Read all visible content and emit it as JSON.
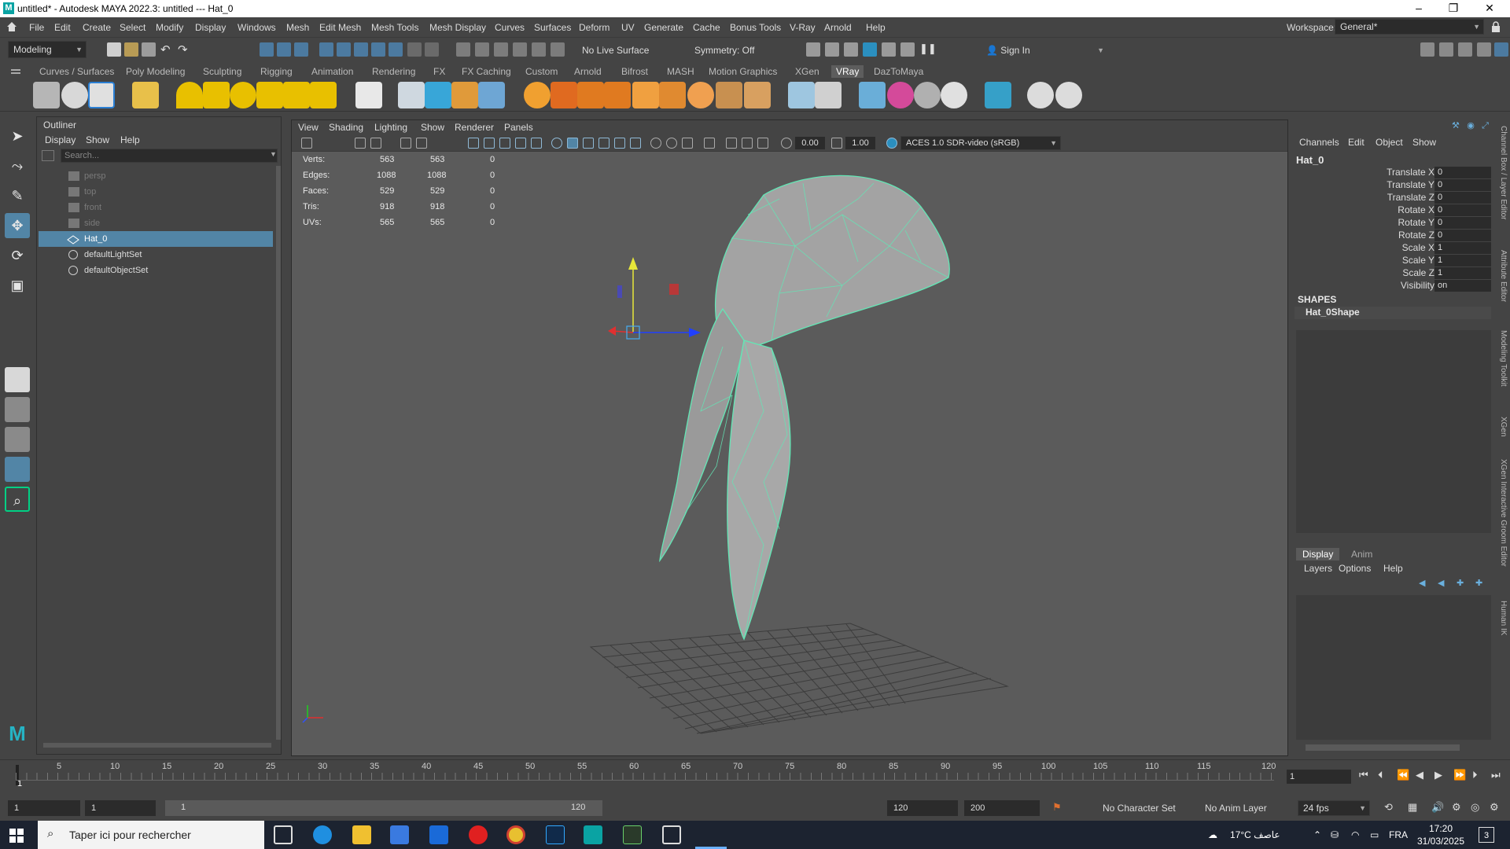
{
  "window": {
    "title": "untitled* - Autodesk MAYA 2022.3: untitled  ---  Hat_0",
    "minimize": "–",
    "maximize": "❐",
    "close": "✕"
  },
  "menubar": {
    "items": [
      "File",
      "Edit",
      "Create",
      "Select",
      "Modify",
      "Display",
      "Windows",
      "Mesh",
      "Edit Mesh",
      "Mesh Tools",
      "Mesh Display",
      "Curves",
      "Surfaces",
      "Deform",
      "UV",
      "Generate",
      "Cache",
      "Bonus Tools",
      "V-Ray",
      "Arnold",
      "Help"
    ],
    "workspace_label": "Workspace:",
    "workspace_value": "General*"
  },
  "statusline": {
    "mode": "Modeling",
    "live_surface": "No Live Surface",
    "symmetry": "Symmetry: Off",
    "sign_in": "Sign In"
  },
  "shelf_tabs": [
    "Curves / Surfaces",
    "Poly Modeling",
    "Sculpting",
    "Rigging",
    "Animation",
    "Rendering",
    "FX",
    "FX Caching",
    "Custom",
    "Arnold",
    "Bifrost",
    "MASH",
    "Motion Graphics",
    "XGen",
    "VRay",
    "DazToMaya"
  ],
  "shelf_active": "VRay",
  "outliner": {
    "title": "Outliner",
    "menu": [
      "Display",
      "Show",
      "Help"
    ],
    "search_placeholder": "Search...",
    "items": [
      {
        "label": "persp",
        "state": "dim"
      },
      {
        "label": "top",
        "state": "dim"
      },
      {
        "label": "front",
        "state": "dim"
      },
      {
        "label": "side",
        "state": "dim"
      },
      {
        "label": "Hat_0",
        "state": "selected"
      },
      {
        "label": "defaultLightSet",
        "state": "normal"
      },
      {
        "label": "defaultObjectSet",
        "state": "normal"
      }
    ]
  },
  "viewport": {
    "menu": [
      "View",
      "Shading",
      "Lighting",
      "Show",
      "Renderer",
      "Panels"
    ],
    "near": "0.00",
    "far": "1.00",
    "color_space": "ACES 1.0 SDR-video (sRGB)",
    "hud": [
      {
        "label": "Verts:",
        "a": "563",
        "b": "563",
        "c": "0"
      },
      {
        "label": "Edges:",
        "a": "1088",
        "b": "1088",
        "c": "0"
      },
      {
        "label": "Faces:",
        "a": "529",
        "b": "529",
        "c": "0"
      },
      {
        "label": "Tris:",
        "a": "918",
        "b": "918",
        "c": "0"
      },
      {
        "label": "UVs:",
        "a": "565",
        "b": "565",
        "c": "0"
      }
    ]
  },
  "channelbox": {
    "menu": [
      "Channels",
      "Edit",
      "Object",
      "Show"
    ],
    "object": "Hat_0",
    "channels": [
      {
        "label": "Translate X",
        "value": "0"
      },
      {
        "label": "Translate Y",
        "value": "0"
      },
      {
        "label": "Translate Z",
        "value": "0"
      },
      {
        "label": "Rotate X",
        "value": "0"
      },
      {
        "label": "Rotate Y",
        "value": "0"
      },
      {
        "label": "Rotate Z",
        "value": "0"
      },
      {
        "label": "Scale X",
        "value": "1"
      },
      {
        "label": "Scale Y",
        "value": "1"
      },
      {
        "label": "Scale Z",
        "value": "1"
      },
      {
        "label": "Visibility",
        "value": "on"
      }
    ],
    "shapes_heading": "SHAPES",
    "shape_name": "Hat_0Shape",
    "side_tabs": [
      "Channel Box / Layer Editor",
      "Attribute Editor",
      "Modeling Toolkit",
      "XGen",
      "XGen Interactive Groom Editor",
      "Human IK"
    ]
  },
  "layers": {
    "tabs": [
      "Display",
      "Anim"
    ],
    "menu": [
      "Layers",
      "Options",
      "Help"
    ]
  },
  "timeline": {
    "ticks": [
      "5",
      "10",
      "15",
      "20",
      "25",
      "30",
      "35",
      "40",
      "45",
      "50",
      "55",
      "60",
      "65",
      "70",
      "75",
      "80",
      "85",
      "90",
      "95",
      "100",
      "105",
      "110",
      "115",
      "120"
    ],
    "current": "1",
    "current_frame_field": "1"
  },
  "range": {
    "start": "1",
    "anim_start": "1",
    "range_start": "1",
    "range_end": "120",
    "anim_end_a": "120",
    "anim_end_b": "200",
    "character_set": "No Character Set",
    "anim_layer": "No Anim Layer",
    "fps": "24 fps"
  },
  "taskbar": {
    "search_placeholder": "Taper ici pour rechercher",
    "weather": "17°C  عاصف",
    "lang": "FRA",
    "time": "17:20",
    "date": "31/03/2025",
    "notif": "3"
  }
}
